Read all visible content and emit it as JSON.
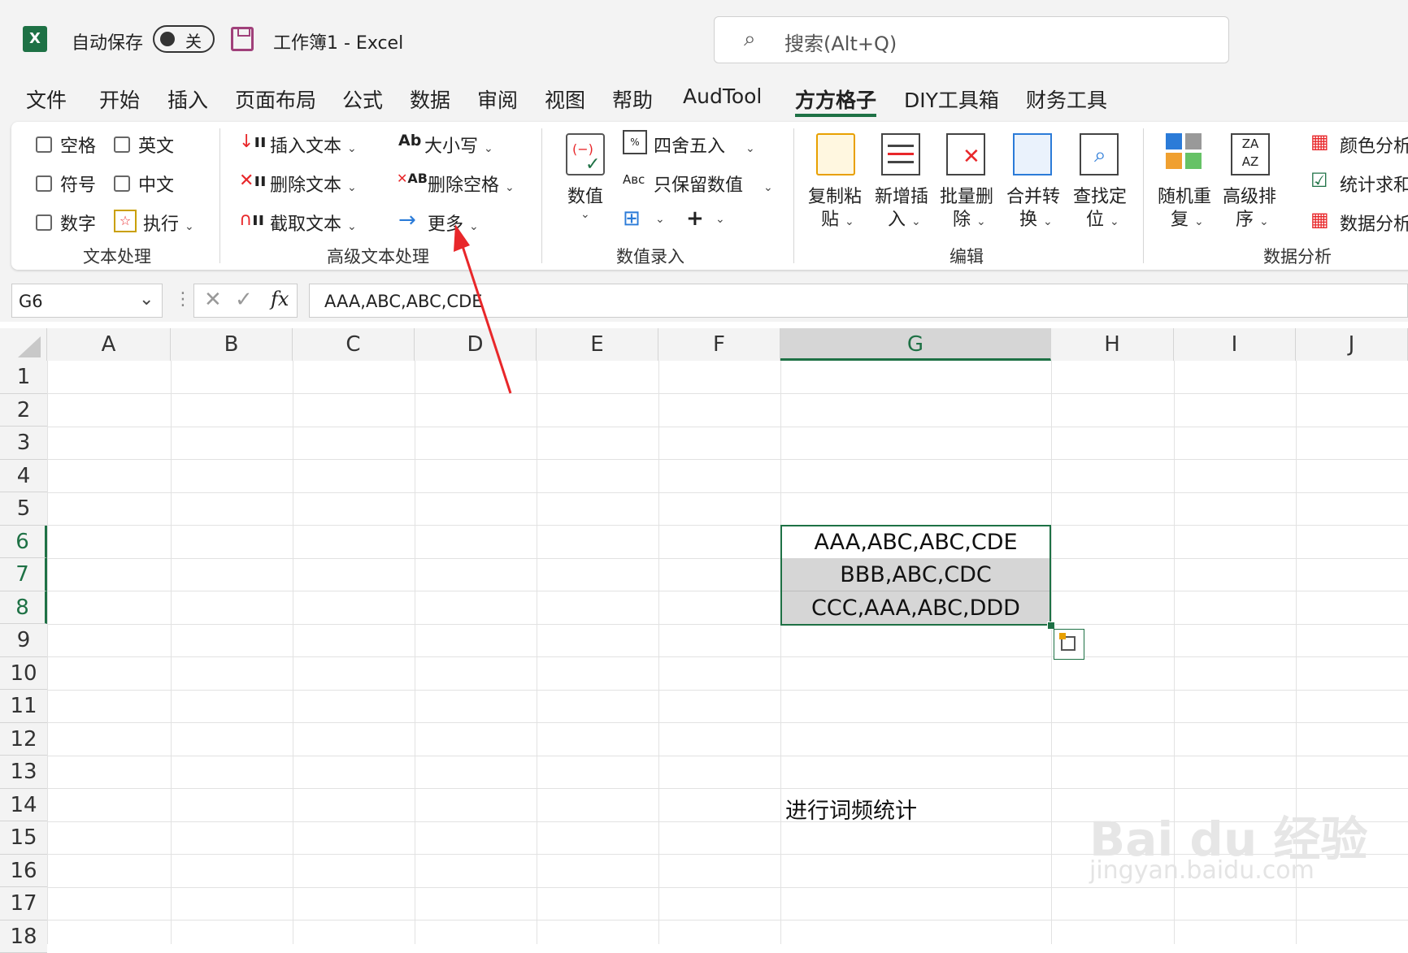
{
  "titlebar": {
    "autosave_label": "自动保存",
    "autosave_state": "关",
    "title": "工作簿1  -  Excel",
    "search_placeholder": "搜索(Alt+Q)"
  },
  "tabs": [
    "文件",
    "开始",
    "插入",
    "页面布局",
    "公式",
    "数据",
    "审阅",
    "视图",
    "帮助",
    "AudTool",
    "方方格子",
    "DIY工具箱",
    "财务工具"
  ],
  "active_tab": "方方格子",
  "ribbon": {
    "text_processing": {
      "checkboxes": [
        "空格",
        "英文",
        "符号",
        "中文",
        "数字"
      ],
      "execute": "执行",
      "group_label": "文本处理"
    },
    "advanced_text": {
      "insert_text": "插入文本",
      "delete_text": "删除文本",
      "cut_text": "截取文本",
      "case": "大小写",
      "delete_spaces": "删除空格",
      "more": "更多",
      "group_label": "高级文本处理"
    },
    "number_entry": {
      "value": "数值",
      "round": "四舍五入",
      "keep_values": "只保留数值",
      "group_label": "数值录入"
    },
    "edit": {
      "copy_paste_1": "复制粘",
      "copy_paste_2": "贴",
      "add_insert_1": "新增插",
      "add_insert_2": "入",
      "batch_delete_1": "批量删",
      "batch_delete_2": "除",
      "merge_convert_1": "合并转",
      "merge_convert_2": "换",
      "find_locate_1": "查找定",
      "find_locate_2": "位",
      "group_label": "编辑"
    },
    "data_analysis": {
      "random_repeat_1": "随机重",
      "random_repeat_2": "复",
      "advanced_sort_1": "高级排",
      "advanced_sort_2": "序",
      "color_analysis": "颜色分析",
      "stats_sum": "统计求和",
      "data_analysis": "数据分析",
      "group_label": "数据分析"
    }
  },
  "formula_bar": {
    "name_box": "G6",
    "fx": "fx",
    "formula": "AAA,ABC,ABC,CDE"
  },
  "sheet": {
    "columns": [
      "A",
      "B",
      "C",
      "D",
      "E",
      "F",
      "G",
      "H",
      "I",
      "J"
    ],
    "rows": [
      "1",
      "2",
      "3",
      "4",
      "5",
      "6",
      "7",
      "8",
      "9",
      "10",
      "11",
      "12",
      "13",
      "14",
      "15",
      "16",
      "17",
      "18"
    ],
    "selected_column": "G",
    "cells": {
      "G6": "AAA,ABC,ABC,CDE",
      "G7": "BBB,ABC,CDC",
      "G8": "CCC,AAA,ABC,DDD",
      "G14": "进行词频统计"
    }
  },
  "watermark": {
    "main": "Bai du 经验",
    "sub": "jingyan.baidu.com"
  },
  "colors": {
    "excel_green": "#1e7145",
    "annotation_red": "#e8272a"
  }
}
